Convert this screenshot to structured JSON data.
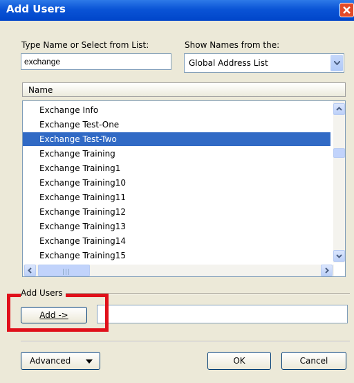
{
  "window": {
    "title": "Add Users"
  },
  "search": {
    "label": "Type Name or Select from List:",
    "value": "exchange"
  },
  "source": {
    "label": "Show Names from the:",
    "selected": "Global Address List"
  },
  "list": {
    "header": "Name",
    "items": [
      "Exchange Info",
      "Exchange Test-One",
      "Exchange Test-Two",
      "Exchange Training",
      "Exchange Training1",
      "Exchange Training10",
      "Exchange Training11",
      "Exchange Training12",
      "Exchange Training13",
      "Exchange Training14",
      "Exchange Training15"
    ],
    "selected_index": 2
  },
  "add_users": {
    "group_label": "Add Users",
    "button_label": "Add ->",
    "value": ""
  },
  "footer": {
    "advanced_label": "Advanced",
    "ok_label": "OK",
    "cancel_label": "Cancel"
  },
  "colors": {
    "selection": "#316ac5",
    "highlight_box": "#e0101a",
    "titlebar": "#0a54d6"
  }
}
